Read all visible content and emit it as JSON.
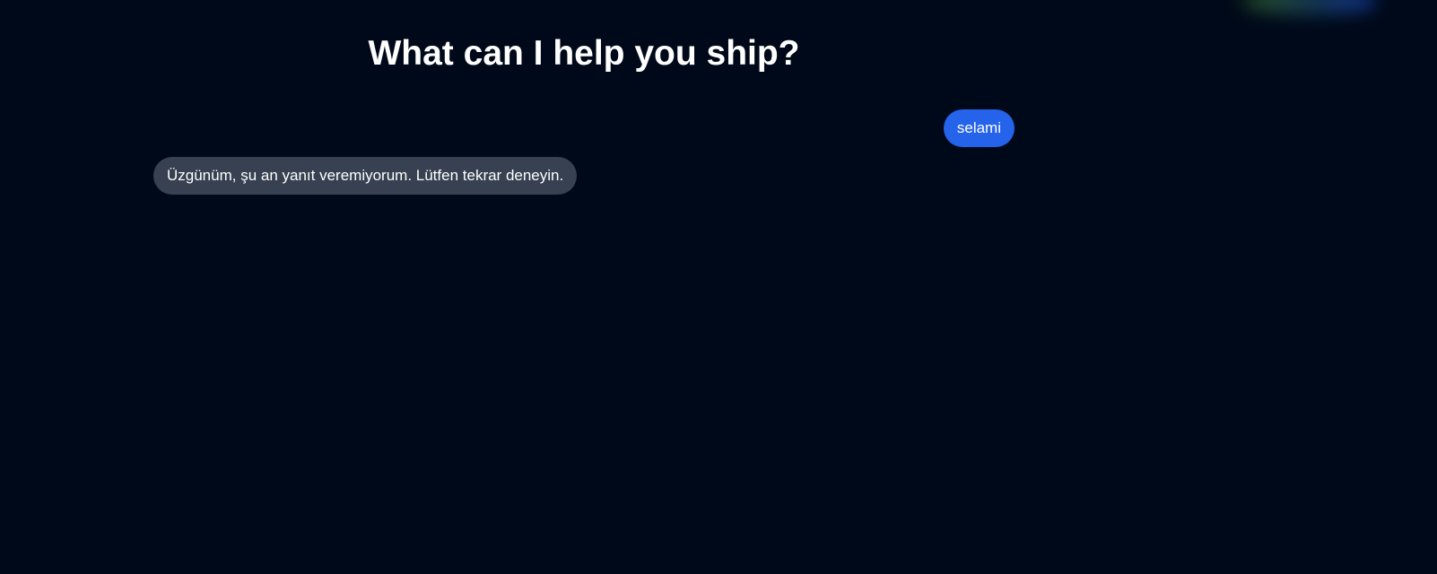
{
  "header": {
    "title": "What can I help you ship?"
  },
  "messages": [
    {
      "role": "user",
      "text": "selami"
    },
    {
      "role": "assistant",
      "text": "Üzgünüm, şu an yanıt veremiyorum. Lütfen tekrar deneyin."
    }
  ],
  "colors": {
    "background": "#000919",
    "user_bubble": "#2563eb",
    "assistant_bubble": "#374151",
    "text": "#ffffff"
  }
}
